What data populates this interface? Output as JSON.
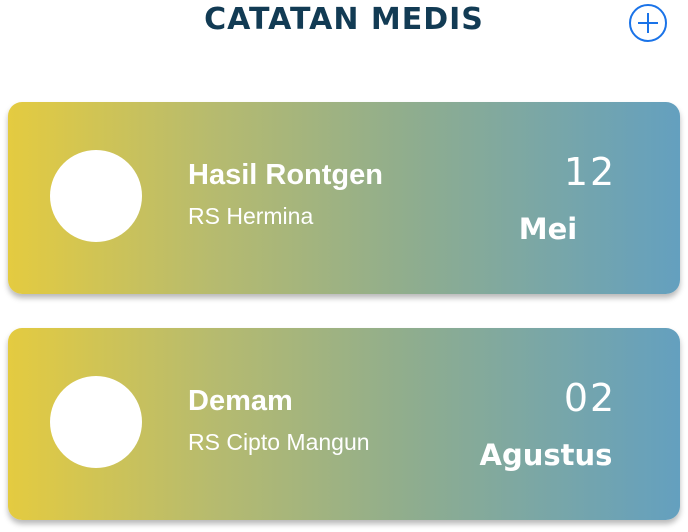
{
  "header": {
    "title": "CATATAN MEDIS",
    "add_icon": "plus-circle-icon",
    "accent_color": "#1a73e8"
  },
  "records": [
    {
      "title": "Hasil Rontgen",
      "hospital": "RS Hermina",
      "day": "12",
      "month": "Mei"
    },
    {
      "title": "Demam",
      "hospital": "RS Cipto Mangun",
      "day": "02",
      "month": "Agustus"
    }
  ],
  "colors": {
    "title_text": "#123b54",
    "card_gradient_start": "#e4cb40",
    "card_gradient_end": "#64a0bf",
    "card_text": "#ffffff"
  }
}
